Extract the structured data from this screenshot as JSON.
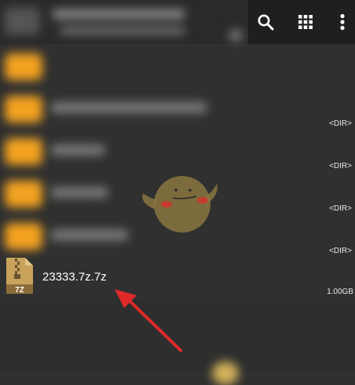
{
  "toolbar": {
    "icons": [
      "search-icon",
      "grid-view-icon",
      "more-vert-icon"
    ]
  },
  "folders": [
    {
      "dir_label": ""
    },
    {
      "dir_label": "<DIR>"
    },
    {
      "dir_label": "<DIR>"
    },
    {
      "dir_label": "<DIR>"
    },
    {
      "dir_label": "<DIR>"
    }
  ],
  "file": {
    "name": "23333.7z.7z",
    "icon_label": "7Z",
    "size": "1.00GB"
  },
  "colors": {
    "folder": "#f2a220",
    "arrow": "#e02a2a",
    "zip_icon": "#c9a25c",
    "background": "#303030"
  }
}
